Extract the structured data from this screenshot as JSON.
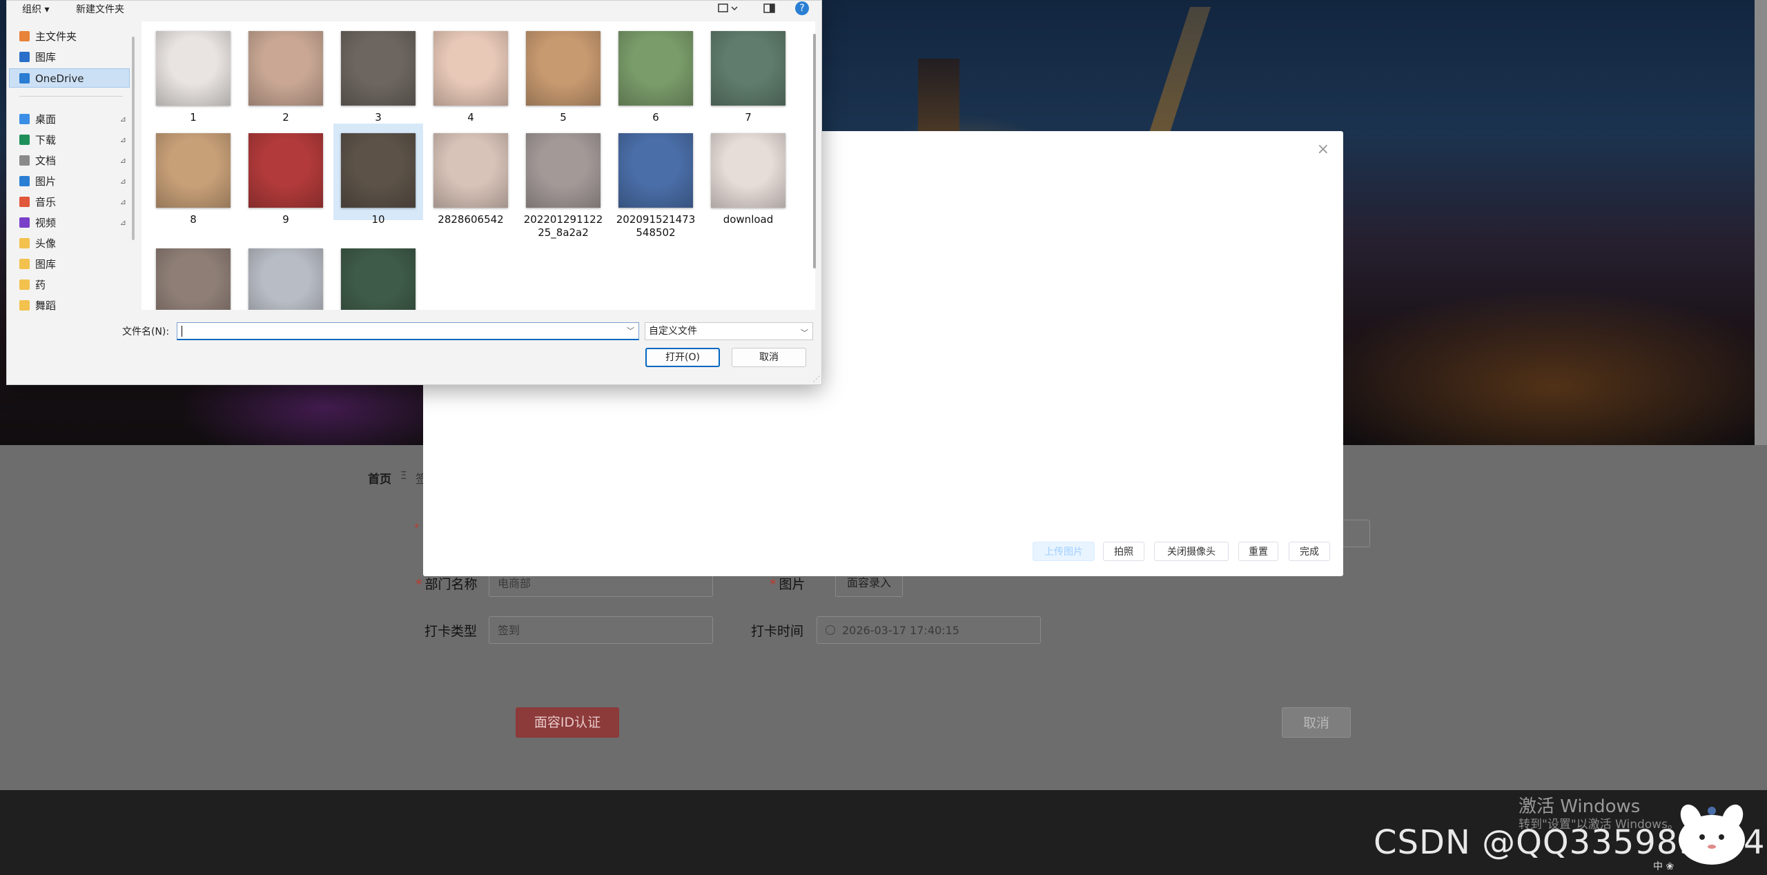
{
  "page": {
    "breadcrumb_home": "首页",
    "breadcrumb_sep": "Ξ",
    "breadcrumb_next": "签",
    "dept_label": "部门名称",
    "dept_value": "电商部",
    "image_label": "图片",
    "face_btn": "面容录入",
    "clock_type_label": "打卡类型",
    "clock_type_value": "签到",
    "clock_time_label": "打卡时间",
    "clock_time_value": "2026-03-17 17:40:15",
    "auth_btn": "面容ID认证",
    "cancel_btn": "取消",
    "required_mark": "*"
  },
  "modal": {
    "close": "×",
    "buttons": {
      "upload": "上传图片",
      "photo": "拍照",
      "close_camera": "关闭摄像头",
      "reset": "重置",
      "done": "完成"
    }
  },
  "dialog": {
    "toolbar": {
      "organize": "组织 ▾",
      "new_folder": "新建文件夹",
      "help": "?"
    },
    "nav": [
      {
        "label": "主文件夹",
        "icon": "home-icon",
        "color": "#e8833a"
      },
      {
        "label": "图库",
        "icon": "gallery-icon",
        "color": "#2a6fc9"
      },
      {
        "label": "OneDrive",
        "icon": "cloud-icon",
        "color": "#2b7cd3"
      },
      {
        "label": "桌面",
        "icon": "desktop-icon",
        "color": "#3a8ee6"
      },
      {
        "label": "下载",
        "icon": "download-icon",
        "color": "#1f8f5a"
      },
      {
        "label": "文档",
        "icon": "document-icon",
        "color": "#8a8a8a"
      },
      {
        "label": "图片",
        "icon": "pictures-icon",
        "color": "#2a7fd4"
      },
      {
        "label": "音乐",
        "icon": "music-icon",
        "color": "#e0573a"
      },
      {
        "label": "视频",
        "icon": "video-icon",
        "color": "#7a3fc9"
      },
      {
        "label": "头像",
        "icon": "folder-icon",
        "color": "#f2c14e"
      },
      {
        "label": "图库",
        "icon": "folder-icon",
        "color": "#f2c14e"
      },
      {
        "label": "药",
        "icon": "folder-icon",
        "color": "#f2c14e"
      },
      {
        "label": "舞蹈",
        "icon": "folder-icon",
        "color": "#f2c14e"
      }
    ],
    "pin": "📌",
    "files": [
      {
        "name": "1",
        "tone": "#e9e4e1"
      },
      {
        "name": "2",
        "tone": "#c9a794"
      },
      {
        "name": "3",
        "tone": "#6d6660"
      },
      {
        "name": "4",
        "tone": "#e8c9b8"
      },
      {
        "name": "5",
        "tone": "#c89a70"
      },
      {
        "name": "6",
        "tone": "#7a9c6a"
      },
      {
        "name": "7",
        "tone": "#5f7c6c"
      },
      {
        "name": "8",
        "tone": "#c8a078"
      },
      {
        "name": "9",
        "tone": "#b23a3a"
      },
      {
        "name": "10",
        "tone": "#5c5248"
      },
      {
        "name": "2828606542",
        "tone": "#d8c3b8"
      },
      {
        "name": "20220129112225_8a2a2",
        "tone": "#a39a98"
      },
      {
        "name": "202091521473548502",
        "tone": "#4a6ea8"
      },
      {
        "name": "download",
        "tone": "#e6dcd8"
      },
      {
        "name": "",
        "tone": "#8e7e76"
      },
      {
        "name": "",
        "tone": "#b8bcc4"
      },
      {
        "name": "",
        "tone": "#3e5a48"
      }
    ],
    "filename_label": "文件名(N):",
    "filename_value": "",
    "filetype": "自定义文件",
    "open_btn": "打开(O)",
    "cancel_btn": "取消"
  },
  "watermark": {
    "activate": "激活 Windows",
    "activate_sub": "转到\"设置\"以激活 Windows。",
    "csdn": "CSDN @QQ335989974",
    "ime": "中 ❀"
  }
}
